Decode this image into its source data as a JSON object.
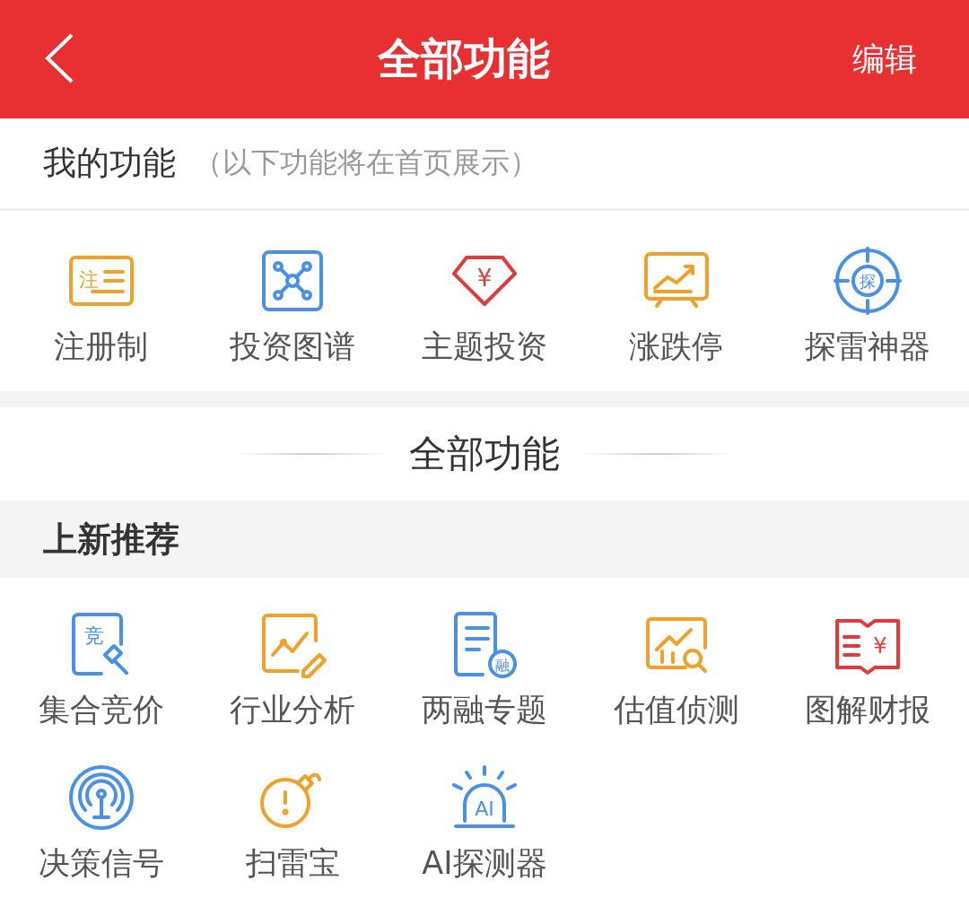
{
  "header": {
    "title": "全部功能",
    "action": "编辑"
  },
  "my_functions": {
    "title": "我的功能",
    "note": "（以下功能将在首页展示）",
    "items": [
      {
        "label": "注册制",
        "kind": "register",
        "glyph": "注"
      },
      {
        "label": "投资图谱",
        "kind": "network"
      },
      {
        "label": "主题投资",
        "kind": "gem",
        "glyph": "¥"
      },
      {
        "label": "涨跌停",
        "kind": "board"
      },
      {
        "label": "探雷神器",
        "kind": "target",
        "glyph": "探"
      }
    ]
  },
  "all_functions": {
    "title": "全部功能"
  },
  "sections": [
    {
      "title": "上新推荐",
      "items": [
        {
          "label": "集合竞价",
          "kind": "auction",
          "glyph": "竞"
        },
        {
          "label": "行业分析",
          "kind": "pen-chart"
        },
        {
          "label": "两融专题",
          "kind": "doc-badge",
          "glyph": "融"
        },
        {
          "label": "估值侦测",
          "kind": "chart-search"
        },
        {
          "label": "图解财报",
          "kind": "book",
          "glyph": "¥"
        },
        {
          "label": "决策信号",
          "kind": "radar"
        },
        {
          "label": "扫雷宝",
          "kind": "bomb"
        },
        {
          "label": "AI探测器",
          "kind": "alarm",
          "glyph": "AI"
        }
      ]
    }
  ]
}
